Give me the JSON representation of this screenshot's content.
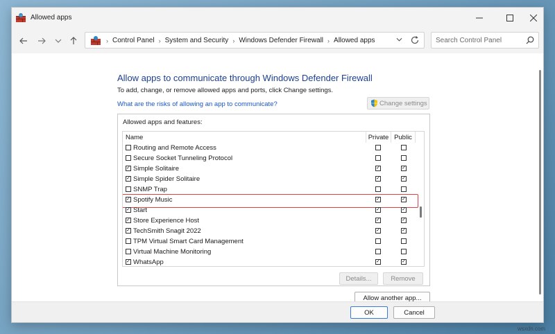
{
  "window": {
    "title": "Allowed apps",
    "controls": {
      "minimize": "minimize",
      "maximize": "maximize",
      "close": "close"
    }
  },
  "navigation": {
    "breadcrumbs": [
      "Control Panel",
      "System and Security",
      "Windows Defender Firewall",
      "Allowed apps"
    ],
    "search_placeholder": "Search Control Panel"
  },
  "main": {
    "heading": "Allow apps to communicate through Windows Defender Firewall",
    "subtext": "To add, change, or remove allowed apps and ports, click Change settings.",
    "risk_link": "What are the risks of allowing an app to communicate?",
    "change_settings_label": "Change settings",
    "group_label": "Allowed apps and features:",
    "columns": {
      "name": "Name",
      "private": "Private",
      "public": "Public"
    },
    "apps": [
      {
        "name": "Routing and Remote Access",
        "enabled": false,
        "private": false,
        "public": false
      },
      {
        "name": "Secure Socket Tunneling Protocol",
        "enabled": false,
        "private": false,
        "public": false
      },
      {
        "name": "Simple Solitaire",
        "enabled": true,
        "private": true,
        "public": true
      },
      {
        "name": "Simple Spider Solitaire",
        "enabled": true,
        "private": true,
        "public": true
      },
      {
        "name": "SNMP Trap",
        "enabled": false,
        "private": false,
        "public": false
      },
      {
        "name": "Spotify Music",
        "enabled": true,
        "private": true,
        "public": true,
        "highlighted": true
      },
      {
        "name": "Start",
        "enabled": true,
        "private": true,
        "public": true
      },
      {
        "name": "Store Experience Host",
        "enabled": true,
        "private": true,
        "public": true
      },
      {
        "name": "TechSmith Snagit 2022",
        "enabled": true,
        "private": true,
        "public": true
      },
      {
        "name": "TPM Virtual Smart Card Management",
        "enabled": false,
        "private": false,
        "public": false
      },
      {
        "name": "Virtual Machine Monitoring",
        "enabled": false,
        "private": false,
        "public": false
      },
      {
        "name": "WhatsApp",
        "enabled": true,
        "private": true,
        "public": true
      }
    ],
    "details_label": "Details...",
    "remove_label": "Remove",
    "allow_another_label": "Allow another app..."
  },
  "footer": {
    "ok_label": "OK",
    "cancel_label": "Cancel"
  },
  "watermark": "wsxdn.com",
  "colors": {
    "heading": "#1c3f8f",
    "link": "#1a56c7",
    "highlight_border": "#e04040"
  }
}
